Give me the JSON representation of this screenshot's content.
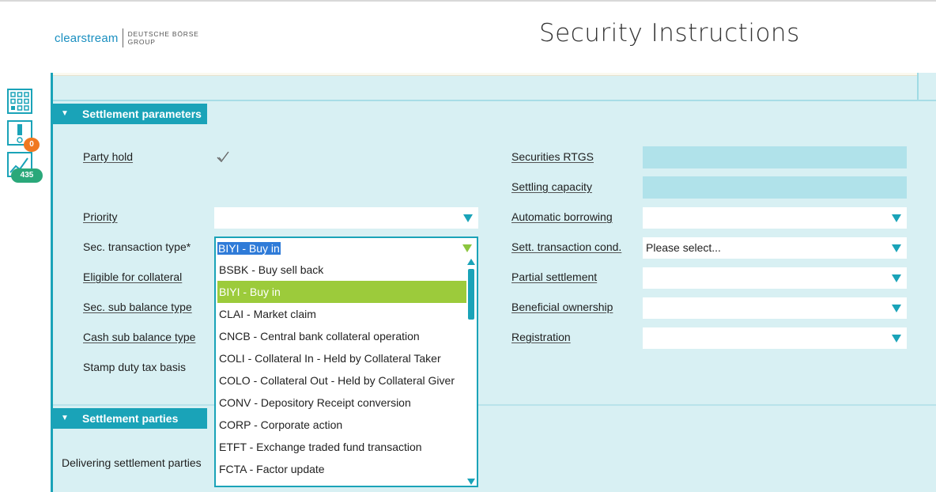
{
  "header": {
    "logo_text": "clearstream",
    "logo_group_line1": "DEUTSCHE BÖRSE",
    "logo_group_line2": "GROUP",
    "title": "Security Instructions"
  },
  "rail": {
    "tasks_badge": "0",
    "activity_badge": "435"
  },
  "sections": {
    "settlement_parameters": "Settlement parameters",
    "settlement_parties": "Settlement parties"
  },
  "left_fields": {
    "party_hold": "Party hold",
    "priority": "Priority",
    "sec_transaction_type": "Sec. transaction type*",
    "eligible_for_collateral": "Eligible for collateral",
    "sec_sub_balance_type": "Sec. sub balance type",
    "cash_sub_balance_type": "Cash sub balance type",
    "stamp_duty_tax_basis": "Stamp duty tax basis",
    "delivering_settlement_parties": "Delivering settlement parties"
  },
  "right_fields": {
    "securities_rtgs": "Securities RTGS",
    "settling_capacity": "Settling capacity",
    "automatic_borrowing": "Automatic borrowing",
    "sett_transaction_cond": "Sett. transaction cond.",
    "sett_transaction_cond_value": "Please select...",
    "partial_settlement": "Partial settlement",
    "beneficial_ownership": "Beneficial ownership",
    "registration": "Registration"
  },
  "dropdown": {
    "selected": "BIYI - Buy in",
    "options": [
      "BSBK - Buy sell back",
      "BIYI - Buy in",
      "CLAI - Market claim",
      "CNCB - Central bank collateral operation",
      "COLI - Collateral In - Held by Collateral Taker",
      "COLO - Collateral Out - Held by Collateral Giver",
      "CONV - Depository Receipt conversion",
      "CORP - Corporate action",
      "ETFT - Exchange traded fund transaction",
      "FCTA - Factor update"
    ]
  },
  "colors": {
    "accent": "#1aa3b8",
    "panel_bg": "#d8f0f3",
    "highlight": "#9ccb3b",
    "badge_orange": "#f07820",
    "badge_green": "#2aa87a"
  }
}
